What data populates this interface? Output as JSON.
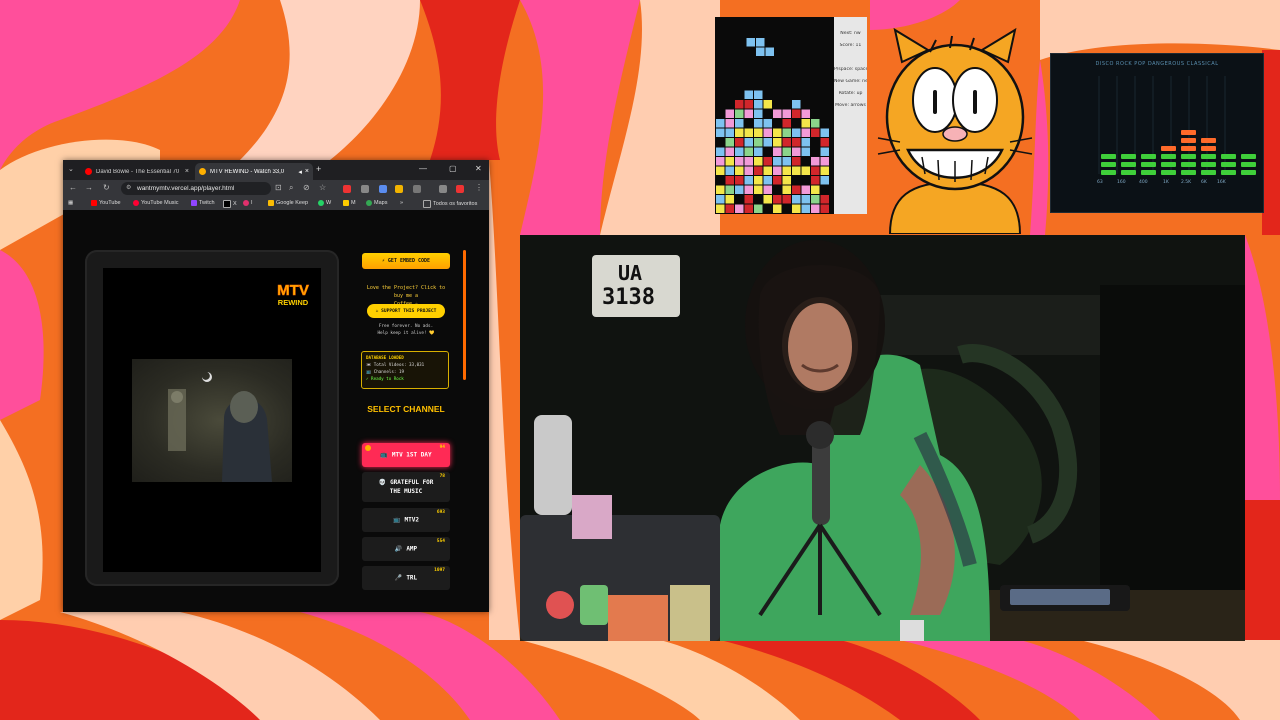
{
  "browser": {
    "tabs": [
      {
        "title": "David Bowie - The Essential 70",
        "favicon_color": "#ff0000"
      },
      {
        "title": "MTV REWIND - Watch 33,0",
        "favicon_color": "#ffb000"
      }
    ],
    "url": "wantmymtv.vercel.app/player.html",
    "bookmarks": [
      "YouTube",
      "YouTube Music",
      "Twitch",
      "X",
      "I",
      "Google Keep",
      "W",
      "M",
      "Maps",
      "Todos os favoritos"
    ]
  },
  "player": {
    "logo_top": "MTV",
    "logo_bottom": "REWIND"
  },
  "sidebar": {
    "embed_button": "⚡ GET EMBED CODE",
    "love_text_1": "Love the Project? Click to buy me a",
    "love_text_2": "Coffee ☕",
    "support_button": "☕ SUPPORT THIS PROJECT",
    "small_text_1": "Free forever. No ads.",
    "small_text_2": "Help keep it alive! 💛",
    "db_title": "DATABASE LOADED",
    "db_videos": "📼 Total Videos: 33,031",
    "db_channels": "📺 Channels: 19",
    "db_ready": "✓ Ready to Rock",
    "select_channel": "SELECT CHANNEL",
    "channels": [
      {
        "icon": "📺",
        "label": "MTV 1ST DAY",
        "count": "94",
        "active": true
      },
      {
        "icon": "💀",
        "label": "GRATEFUL FOR THE MUSIC",
        "count": "78",
        "active": false
      },
      {
        "icon": "📺",
        "label": "MTV2",
        "count": "693",
        "active": false
      },
      {
        "icon": "🔊",
        "label": "AMP",
        "count": "554",
        "active": false
      },
      {
        "icon": "🎤",
        "label": "TRL",
        "count": "1097",
        "active": false
      }
    ]
  },
  "tetris": {
    "next_label": "Next: nw",
    "score_label": "Score: 11",
    "pause_label": "P/space: space",
    "newgame_label": "New Game: new",
    "rotate_label": "Rotate: up",
    "move_label": "Move: arrows"
  },
  "equalizer": {
    "header": "DISCO ROCK  POP DANGEROUS CLASSICAL",
    "freq_labels": [
      "63",
      "160",
      "400",
      "1K",
      "2.5K",
      "6K",
      "16K"
    ]
  },
  "webcam": {
    "plate_line1": "UA",
    "plate_line2": "3138"
  }
}
